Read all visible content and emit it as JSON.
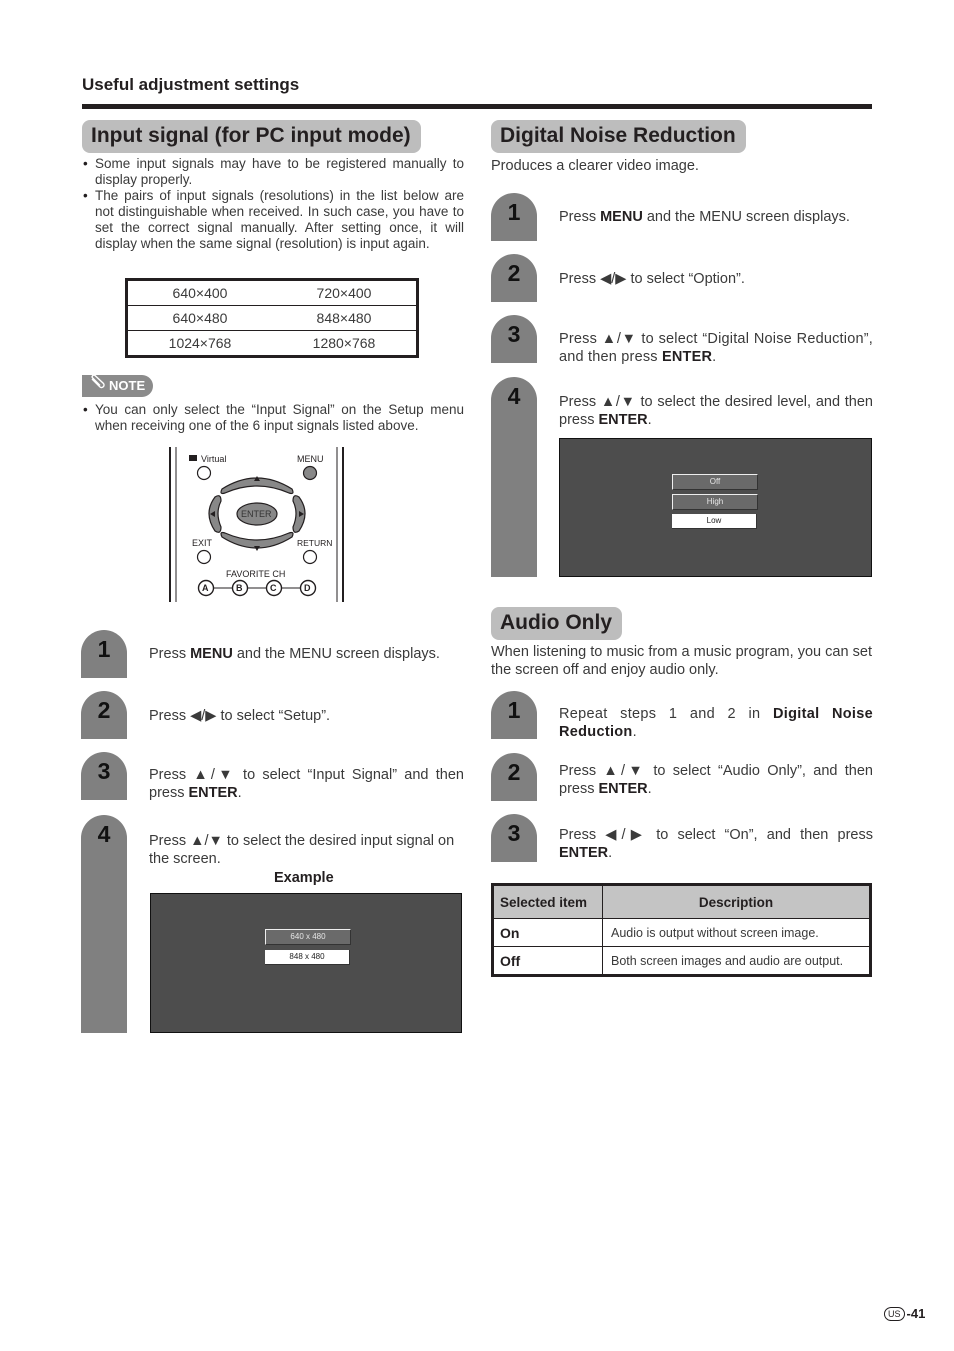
{
  "header": {
    "section": "Useful adjustment settings"
  },
  "input_signal": {
    "title": "Input signal (for PC input mode)",
    "bullets": [
      "Some input signals may have to be registered manually to display properly.",
      "The pairs of input signals (resolutions) in the list below are not distinguishable when received. In such case, you have to set the correct signal manually. After setting once, it will display when the same signal (resolution) is input again."
    ],
    "resolution_table": [
      [
        "640×400",
        "720×400"
      ],
      [
        "640×480",
        "848×480"
      ],
      [
        "1024×768",
        "1280×768"
      ]
    ],
    "note_label": "NOTE",
    "note_icon": "paperclip-icon",
    "note_text": "You can only select the “Input Signal” on the Setup menu when receiving one of the 6 input signals listed above.",
    "remote": {
      "virtual_label": "Virtual",
      "menu_label": "MENU",
      "enter_label": "ENTER",
      "exit_label": "EXIT",
      "return_label": "RETURN",
      "favorite_label": "FAVORITE CH",
      "fav_buttons": [
        "A",
        "B",
        "C",
        "D"
      ]
    },
    "steps": [
      {
        "num": "1",
        "pre": "Press ",
        "bold": "MENU",
        "post": " and the MENU screen displays."
      },
      {
        "num": "2",
        "pre": "Press ◀/▶ to select “Setup”.",
        "bold": "",
        "post": ""
      },
      {
        "num": "3",
        "pre": "Press ▲/▼ to select “Input Signal” and then press ",
        "bold": "ENTER",
        "post": "."
      },
      {
        "num": "4",
        "pre": "Press ▲/▼ to select the desired input signal on the screen.",
        "bold": "",
        "post": ""
      }
    ],
    "example_label": "Example",
    "screen_menu": [
      "640 x 480",
      "848 x 480"
    ],
    "screen_selected": "848 x 480"
  },
  "dnr": {
    "title": "Digital Noise Reduction",
    "intro": "Produces a clearer video image.",
    "steps": [
      {
        "num": "1",
        "pre": "Press ",
        "bold": "MENU",
        "post": " and the MENU screen displays."
      },
      {
        "num": "2",
        "pre": "Press ◀/▶ to select “Option”.",
        "bold": "",
        "post": ""
      },
      {
        "num": "3",
        "pre": "Press ▲/▼ to select “Digital Noise Reduction”, and then press ",
        "bold": "ENTER",
        "post": "."
      },
      {
        "num": "4",
        "pre": "Press ▲/▼ to select the desired level, and then press ",
        "bold": "ENTER",
        "post": "."
      }
    ],
    "screen_menu": [
      "Off",
      "High",
      "Low"
    ],
    "screen_selected": "Low"
  },
  "audio_only": {
    "title": "Audio Only",
    "intro": "When listening to music from a music program, you can set the screen off and enjoy audio only.",
    "steps": [
      {
        "num": "1",
        "pre": "Repeat steps 1 and 2 in ",
        "bold": "Digital Noise Reduction",
        "post": "."
      },
      {
        "num": "2",
        "pre": "Press ▲/▼ to select “Audio Only”, and then press ",
        "bold": "ENTER",
        "post": "."
      },
      {
        "num": "3",
        "pre": "Press ◀/▶ to select “On”, and then press ",
        "bold": "ENTER",
        "post": "."
      }
    ],
    "table": {
      "headers": [
        "Selected item",
        "Description"
      ],
      "rows": [
        [
          "On",
          "Audio is output without screen image."
        ],
        [
          "Off",
          "Both screen images and audio are output."
        ]
      ]
    }
  },
  "footer": {
    "region_badge": "US",
    "page": "-41"
  }
}
